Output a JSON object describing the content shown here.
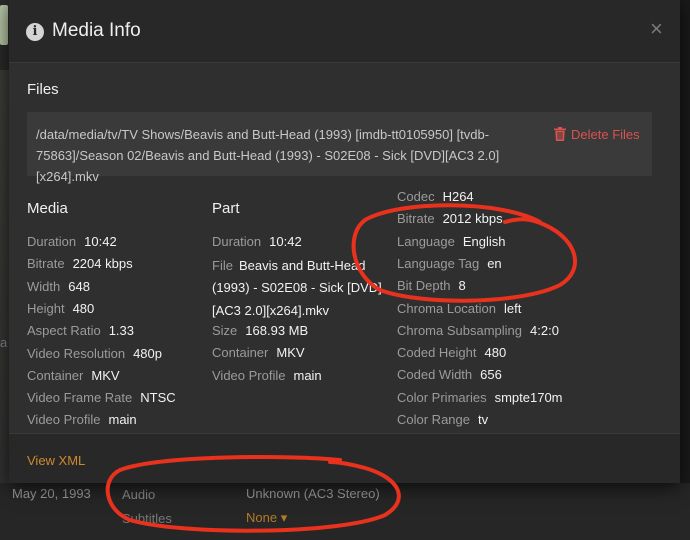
{
  "modal": {
    "title": "Media Info",
    "close_symbol": "×",
    "files_heading": "Files",
    "file_path": "/data/media/tv/TV Shows/Beavis and Butt-Head (1993) [imdb-tt0105950] [tvdb-75863]/Season 02/Beavis and Butt-Head (1993) - S02E08 - Sick [DVD][AC3 2.0][x264].mkv",
    "delete_label": "Delete Files",
    "footer_link": "View XML"
  },
  "media": {
    "heading": "Media",
    "rows": [
      {
        "k": "Duration",
        "v": "10:42"
      },
      {
        "k": "Bitrate",
        "v": "2204 kbps"
      },
      {
        "k": "Width",
        "v": "648"
      },
      {
        "k": "Height",
        "v": "480"
      },
      {
        "k": "Aspect Ratio",
        "v": "1.33"
      },
      {
        "k": "Video Resolution",
        "v": "480p"
      },
      {
        "k": "Container",
        "v": "MKV"
      },
      {
        "k": "Video Frame Rate",
        "v": "NTSC"
      },
      {
        "k": "Video Profile",
        "v": "main"
      }
    ]
  },
  "part": {
    "heading": "Part",
    "duration": {
      "k": "Duration",
      "v": "10:42"
    },
    "file": {
      "k": "File",
      "v": "Beavis and Butt-Head (1993) - S02E08 - Sick [DVD][AC3 2.0][x264].mkv"
    },
    "rows": [
      {
        "k": "Size",
        "v": "168.93 MB"
      },
      {
        "k": "Container",
        "v": "MKV"
      },
      {
        "k": "Video Profile",
        "v": "main"
      }
    ]
  },
  "stream": {
    "rows": [
      {
        "k": "Codec",
        "v": "H264"
      },
      {
        "k": "Bitrate",
        "v": "2012 kbps"
      },
      {
        "k": "Language",
        "v": "English"
      },
      {
        "k": "Language Tag",
        "v": "en"
      },
      {
        "k": "Bit Depth",
        "v": "8"
      },
      {
        "k": "Chroma Location",
        "v": "left"
      },
      {
        "k": "Chroma Subsampling",
        "v": "4:2:0"
      },
      {
        "k": "Coded Height",
        "v": "480"
      },
      {
        "k": "Coded Width",
        "v": "656"
      },
      {
        "k": "Color Primaries",
        "v": "smpte170m"
      },
      {
        "k": "Color Range",
        "v": "tv"
      }
    ]
  },
  "background": {
    "date": "May 20, 1993",
    "audio_label": "Audio",
    "audio_value": "Unknown (AC3 Stereo)",
    "subtitles_label": "Subtitles",
    "subtitles_value": "None ▾",
    "ghost_letter": "a"
  },
  "colors": {
    "accent": "#cc8a2e",
    "danger": "#d9534f",
    "annotation": "#e8321e"
  }
}
